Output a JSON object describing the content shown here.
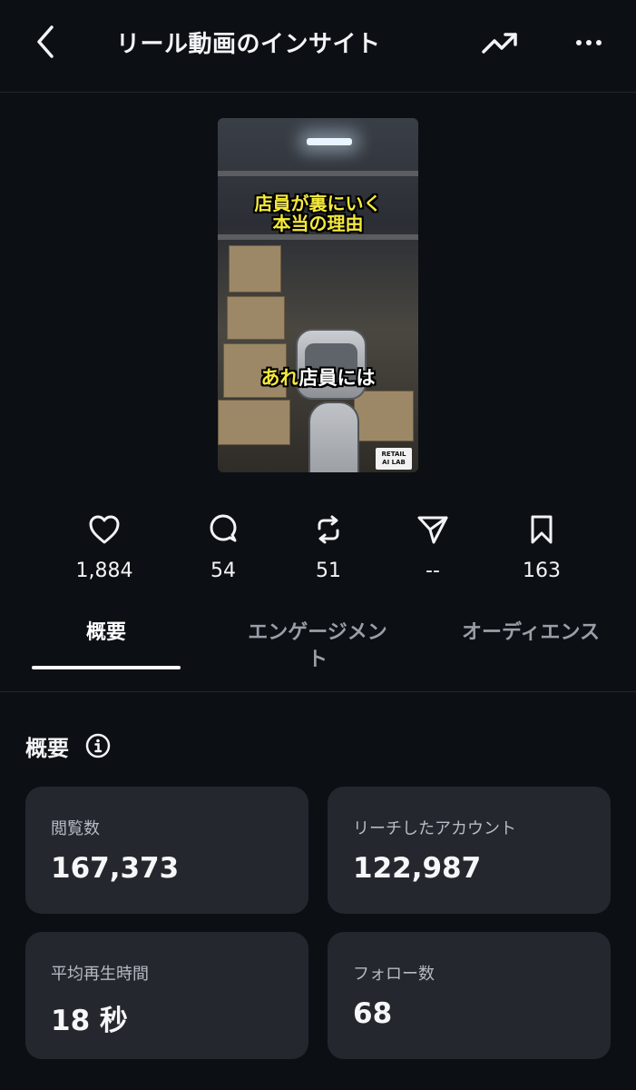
{
  "header": {
    "title": "リール動画のインサイト",
    "back_icon": "chevron-left-icon",
    "trend_icon": "trending-up-icon",
    "more_icon": "more-horizontal-icon"
  },
  "thumbnail": {
    "caption_line1": "店員が裏にいく",
    "caption_line2": "本当の理由",
    "caption_bottom_highlight": "あれ",
    "caption_bottom_rest": "店員には",
    "logo_text_1": "RETAIL",
    "logo_text_2": "AI LAB"
  },
  "stats": [
    {
      "icon": "heart-icon",
      "value": "1,884"
    },
    {
      "icon": "comment-icon",
      "value": "54"
    },
    {
      "icon": "repost-icon",
      "value": "51"
    },
    {
      "icon": "send-icon",
      "value": "--"
    },
    {
      "icon": "bookmark-icon",
      "value": "163"
    }
  ],
  "tabs": [
    {
      "label": "概要",
      "active": true
    },
    {
      "label_line1": "エンゲージメン",
      "label_line2": "ト",
      "active": false
    },
    {
      "label": "オーディエンス",
      "active": false
    }
  ],
  "overview": {
    "title": "概要",
    "info_icon": "info-icon",
    "cards": [
      {
        "label": "閲覧数",
        "value": "167,373"
      },
      {
        "label": "リーチしたアカウント",
        "value": "122,987"
      },
      {
        "label": "平均再生時間",
        "value": "18 秒"
      },
      {
        "label": "フォロー数",
        "value": "68"
      }
    ]
  },
  "colors": {
    "background": "#0c0f14",
    "card": "#24272d",
    "caption_yellow": "#f5e93c"
  }
}
